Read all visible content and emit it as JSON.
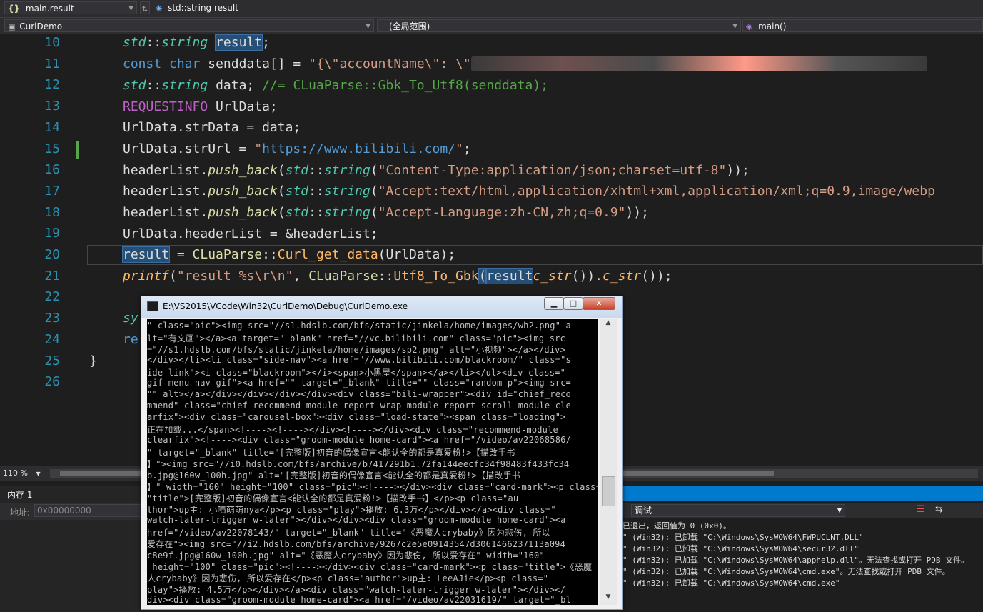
{
  "nav": {
    "file_combo": "main.result",
    "member_combo": "std::string result",
    "project_combo": "CurlDemo",
    "scope_combo": "(全局范围)",
    "function_combo": "main()"
  },
  "code": {
    "line_numbers": [
      "10",
      "11",
      "12",
      "13",
      "14",
      "15",
      "16",
      "17",
      "18",
      "19",
      "20",
      "21",
      "22",
      "23",
      "24",
      "25",
      "26"
    ],
    "l10": {
      "ns": "std",
      "sep": "::",
      "type": "string",
      "var": "result",
      "end": ";"
    },
    "l11": {
      "kw1": "const",
      "kw2": "char",
      "rest": " senddata[] = ",
      "str": "\"{\\\"accountName\\\": \\\""
    },
    "l12": {
      "ns": "std",
      "sep": "::",
      "type": "string",
      "rest": " data; ",
      "comment": "//= CLuaParse::Gbk_To_Utf8(senddata);"
    },
    "l13": {
      "macro": "REQUESTINFO",
      "rest": " UrlData;"
    },
    "l14": {
      "text": "UrlData.strData = data;"
    },
    "l15": {
      "pre": "UrlData.strUrl = ",
      "q1": "\"",
      "url": "https://www.bilibili.com/",
      "q2": "\"",
      "end": ";"
    },
    "l16": {
      "obj": "headerList.",
      "fn": "push_back",
      "p1": "(",
      "ns": "std",
      "sep": "::",
      "type": "string",
      "p2": "(",
      "str": "\"Content-Type:application/json;charset=utf-8\"",
      "end": "));"
    },
    "l17": {
      "obj": "headerList.",
      "fn": "push_back",
      "p1": "(",
      "ns": "std",
      "sep": "::",
      "type": "string",
      "p2": "(",
      "str": "\"Accept:text/html,application/xhtml+xml,application/xml;q=0.9,image/webp"
    },
    "l18": {
      "obj": "headerList.",
      "fn": "push_back",
      "p1": "(",
      "ns": "std",
      "sep": "::",
      "type": "string",
      "p2": "(",
      "str": "\"Accept-Language:zh-CN,zh;q=0.9\"",
      "end": "));"
    },
    "l19": {
      "text": "UrlData.headerList = &headerList;"
    },
    "l20": {
      "var": "result",
      "eq": " = ",
      "cls": "CLuaParse",
      "sep": "::",
      "fn": "Curl_get_data",
      "rest": "(UrlData);"
    },
    "l21": {
      "fn": "printf",
      "p": "(",
      "str": "\"result %s\\r\\n\"",
      "c": ", ",
      "cls": "CLuaParse",
      "sep": "::",
      "fn2": "Utf8_To_Gbk",
      "p2": "(",
      "var": "result",
      ".": ".",
      "fn3": "c_str",
      "mid": "()).",
      "fn4": "c_str",
      "end": "());"
    },
    "l23": {
      "text": "sy"
    },
    "l24": {
      "text": "re"
    },
    "l25": {
      "text": "}"
    }
  },
  "zoom": "110 %",
  "memory_panel": {
    "title": "内存 1",
    "address_label": "地址:",
    "address_value": "0x00000000"
  },
  "output_panel": {
    "source_label": "调试",
    "lines": [
      "已退出，返回值为 0 (0x0)。",
      "\" (Win32): 已卸载 \"C:\\Windows\\SysWOW64\\FWPUCLNT.DLL\"",
      "\" (Win32): 已卸载 \"C:\\Windows\\SysWOW64\\secur32.dll\"",
      "\" (Win32): 已加载 \"C:\\Windows\\SysWOW64\\apphelp.dll\"。无法查找或打开 PDB 文件。",
      "\" (Win32): 已加载 \"C:\\Windows\\SysWOW64\\cmd.exe\"。无法查找或打开 PDB 文件。",
      "\" (Win32): 已卸载 \"C:\\Windows\\SysWOW64\\cmd.exe\""
    ]
  },
  "console": {
    "title": "E:\\VS2015\\VCode\\Win32\\CurlDemo\\Debug\\CurlDemo.exe",
    "lines": [
      "\" class=\"pic\"><img src=\"//s1.hdslb.com/bfs/static/jinkela/home/images/wh2.png\" a",
      "lt=\"有文画\"></a><a target=\"_blank\" href=\"//vc.bilibili.com\" class=\"pic\"><img src",
      "=\"//s1.hdslb.com/bfs/static/jinkela/home/images/sp2.png\" alt=\"小视频\"></a></div>",
      "</div></li><li class=\"side-nav\"><a href=\"//www.bilibili.com/blackroom/\" class=\"s",
      "ide-link\"><i class=\"blackroom\"></i><span>小黑屋</span></a></li></ul><div class=\"",
      "gif-menu nav-gif\"><a href=\"\" target=\"_blank\" title=\"\" class=\"random-p\"><img src=",
      "\"\" alt></a></div></div></div></div><div class=\"bili-wrapper\"><div id=\"chief_reco",
      "mmend\" class=\"chief-recommend-module report-wrap-module report-scroll-module cle",
      "arfix\"><div class=\"carousel-box\"><div class=\"load-state\"><span class=\"loading\">",
      "正在加载...</span><!----><!----></div><!----></div><div class=\"recommend-module",
      "clearfix\"><!----><div class=\"groom-module home-card\"><a href=\"/video/av22068586/",
      "\" target=\"_blank\" title=\"[完整版]初音的偶像宣言<能认全的都是真爱粉!>【描改手书",
      "】\"><img src=\"//i0.hdslb.com/bfs/archive/b7417291b1.72fa144eecfc34f98483f433fc34",
      "b.jpg@160w_100h.jpg\" alt=\"[完整版]初音的偶像宣言<能认全的都是真爱粉!>【描改手书",
      "】\" width=\"160\" height=\"100\" class=\"pic\"><!----></div><div class=\"card-mark\"><p class=",
      "\"title\">[完整版]初音的偶像宣言<能认全的都是真爱粉!>【描改手书】</p><p class=\"au",
      "thor\">up主: 小喵萌萌nya</p><p class=\"play\">播放: 6.3万</p></div></a><div class=\"",
      "watch-later-trigger w-later\"></div></div><div class=\"groom-module home-card\"><a",
      "href=\"/video/av22078143/\" target=\"_blank\" title=\"《恶魔人crybaby》因为悲伤, 所以",
      "爱存在\"><img src=\"//i2.hdslb.com/bfs/archive/9267c2e5e09143547d3061466237113a094",
      "c8e9f.jpg@160w_100h.jpg\" alt=\"《恶魔人crybaby》因为悲伤, 所以爱存在\" width=\"160\"",
      " height=\"100\" class=\"pic\"><!----></div><div class=\"card-mark\"><p class=\"title\">《恶魔",
      "人crybaby》因为悲伤, 所以爱存在</p><p class=\"author\">up主: LeeAJie</p><p class=\"",
      "play\">播放: 4.5万</p></div></a><div class=\"watch-later-trigger w-later\"></div></",
      "div><div class=\"groom-module home-card\"><a href=\"/video/av22031619/\" target=\"_bl"
    ]
  }
}
